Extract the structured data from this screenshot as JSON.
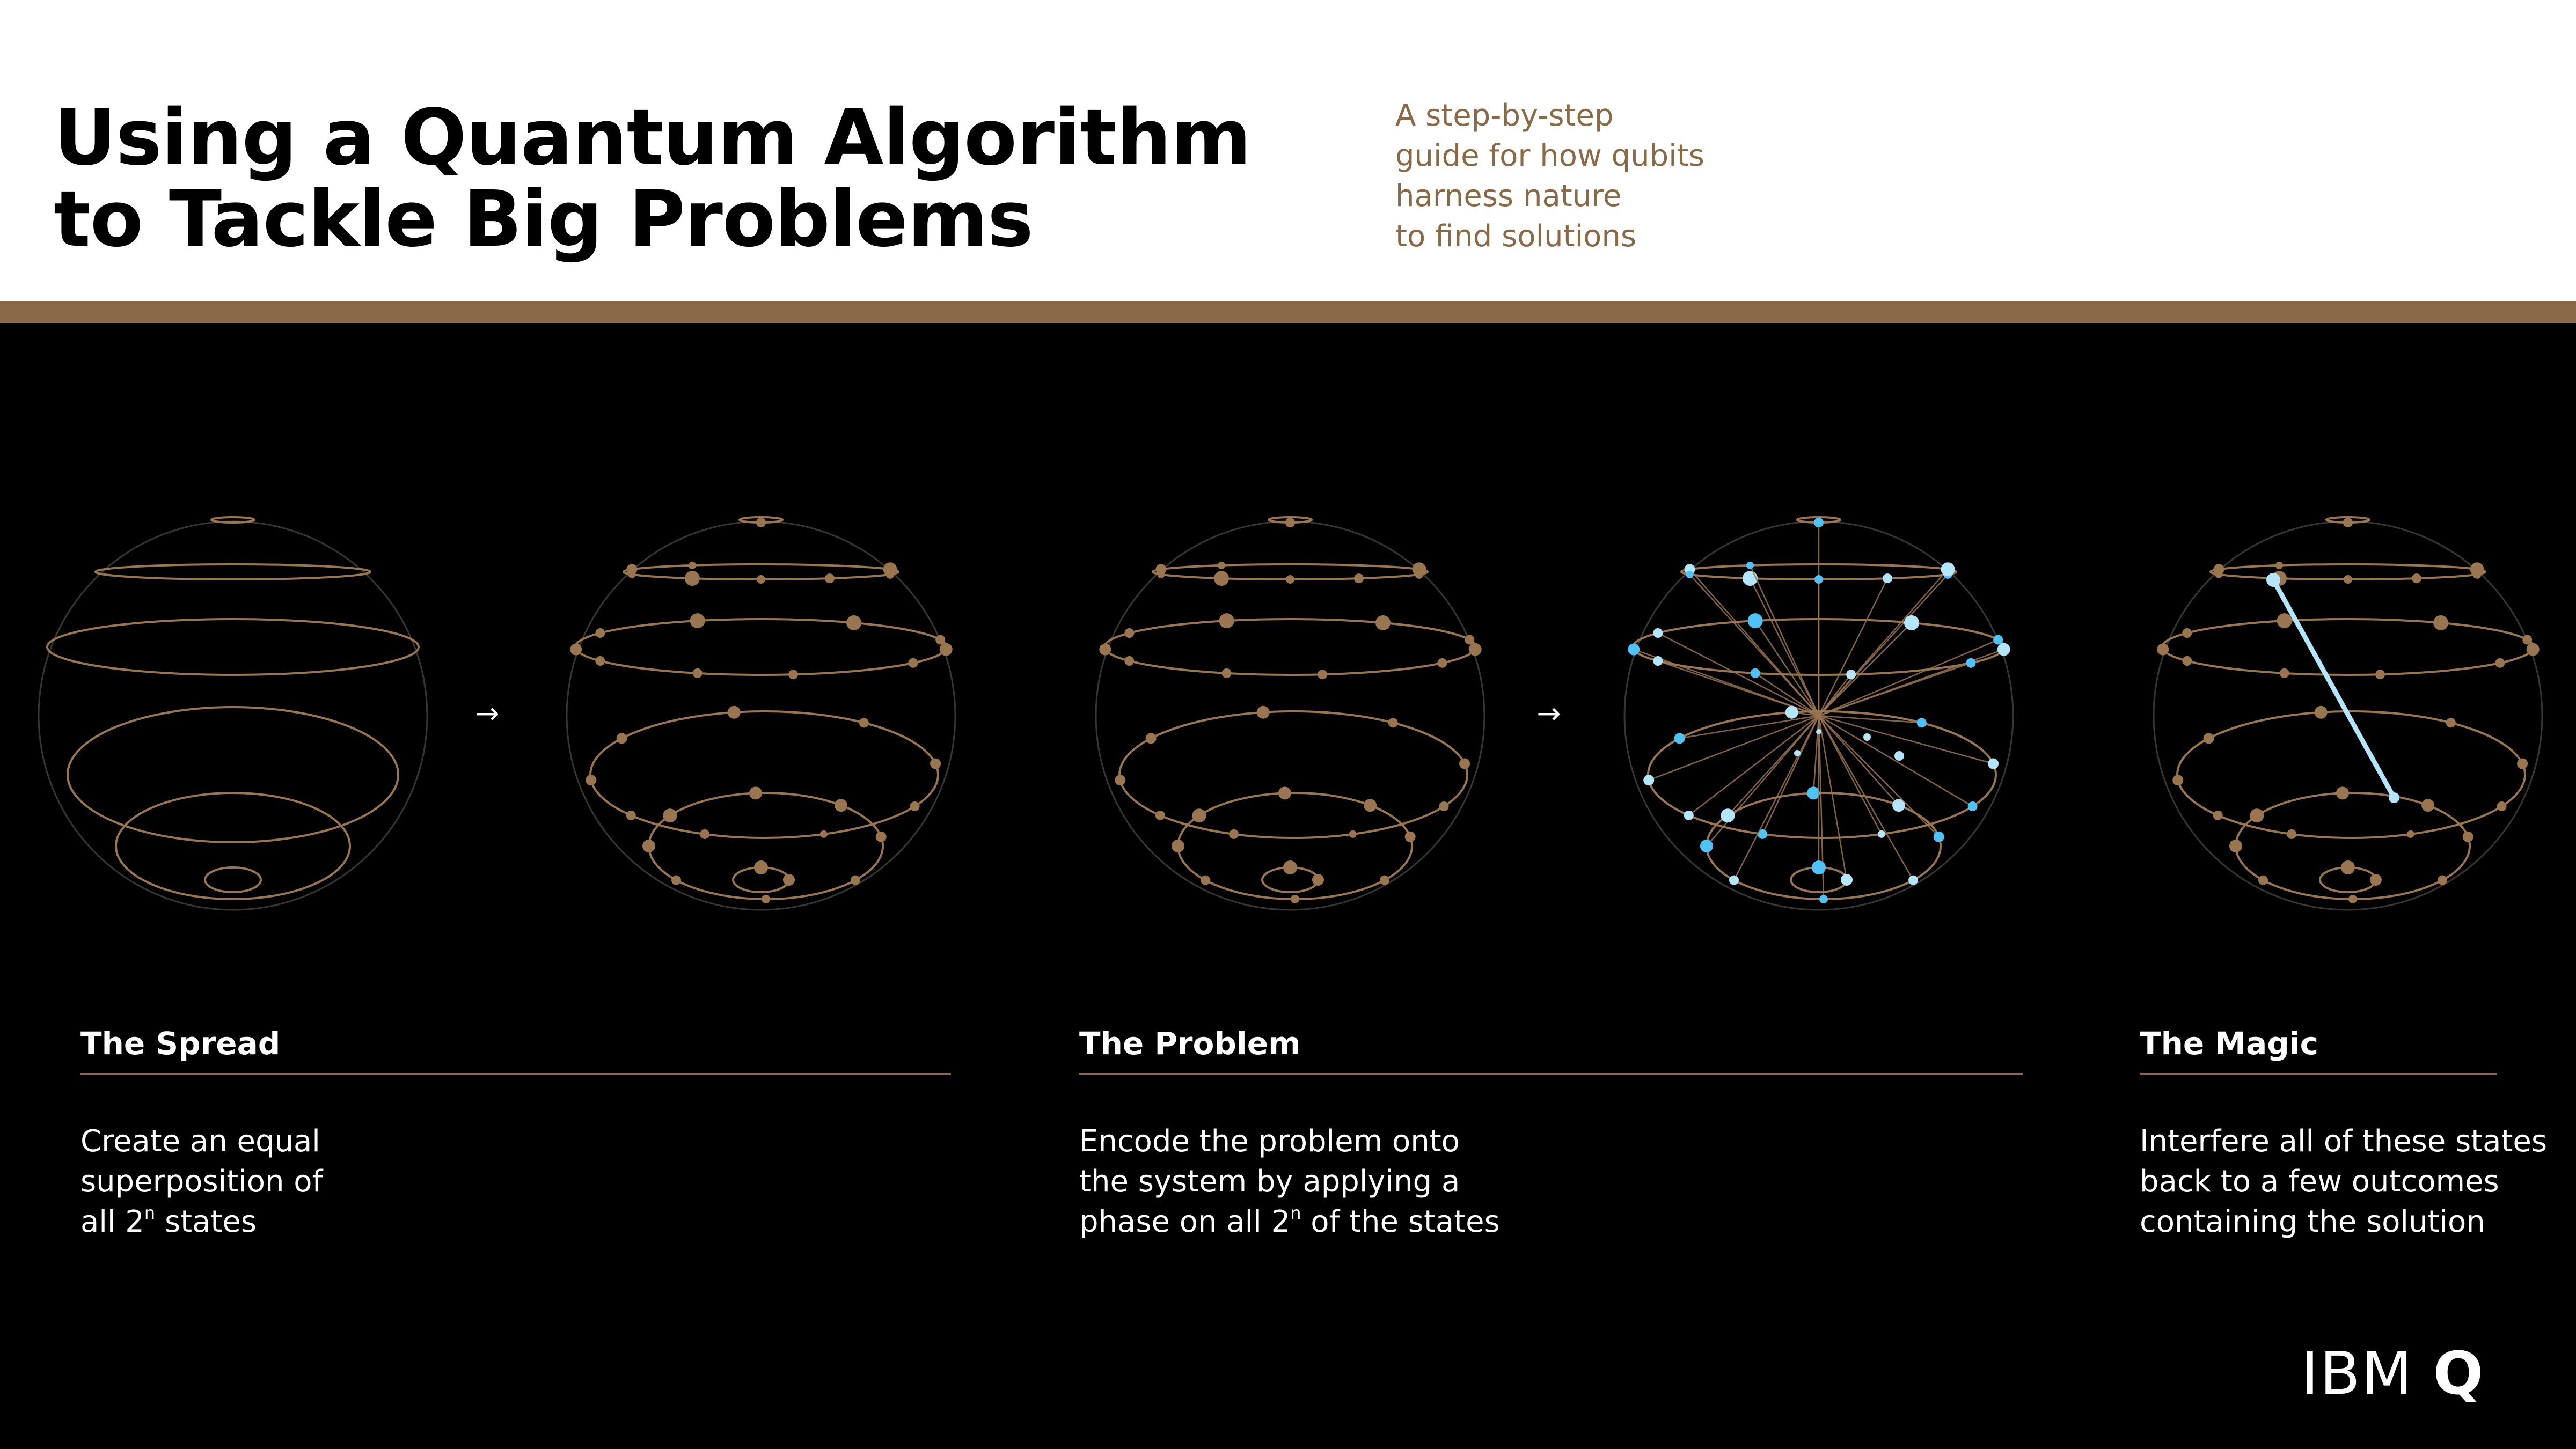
{
  "header": {
    "title_line1": "Using a Quantum Algorithm",
    "title_line2": "to Tackle Big Problems",
    "subtitle_lines": [
      "A step-by-step",
      "guide for how qubits",
      "harness nature",
      "to find solutions"
    ]
  },
  "colors": {
    "accent": "#8a6a46",
    "qubit_brown": "#9a7650",
    "qubit_blue": "#4fc3f7",
    "qubit_light_blue": "#b3e5fc",
    "outline": "#3a3530",
    "background": "#000000",
    "header_bg": "#ffffff"
  },
  "diagram": {
    "arrow_glyph": "→",
    "sphere_labels": [
      "empty-sphere",
      "spread-sphere",
      "encoded-sphere",
      "phase-sphere",
      "interference-sphere"
    ]
  },
  "panels": [
    {
      "heading": "The Spread",
      "lines": [
        {
          "text": "Create an equal"
        },
        {
          "text": "superposition of"
        },
        {
          "pre": "all 2",
          "sup": "n",
          "post": " states"
        }
      ]
    },
    {
      "heading": "The Problem",
      "lines": [
        {
          "text": "Encode the problem onto"
        },
        {
          "text": "the system by applying a"
        },
        {
          "pre": "phase on all 2",
          "sup": "n",
          "post": " of the states"
        }
      ]
    },
    {
      "heading": "The Magic",
      "lines": [
        {
          "text": "Interfere all of these states"
        },
        {
          "text": "back to a few outcomes"
        },
        {
          "text": "containing the solution"
        }
      ]
    }
  ],
  "logo": {
    "text_light": "IBM ",
    "text_bold": "Q"
  }
}
